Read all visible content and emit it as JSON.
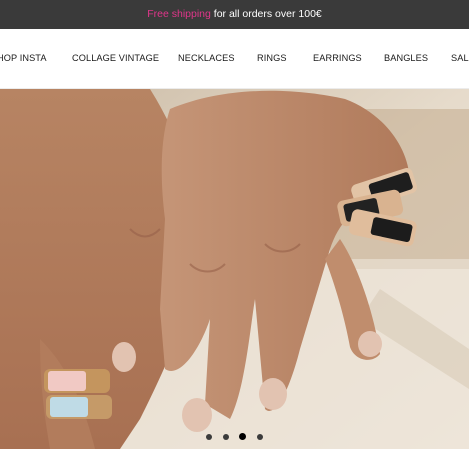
{
  "announcement": {
    "highlight": "Free shipping",
    "rest": " for all orders over 100€"
  },
  "nav": {
    "items": [
      {
        "label": "HOP INSTA"
      },
      {
        "label": "COLLAGE VINTAGE"
      },
      {
        "label": "NECKLACES"
      },
      {
        "label": "RINGS"
      },
      {
        "label": "EARRINGS"
      },
      {
        "label": "BANGLES"
      },
      {
        "label": "SALE"
      }
    ]
  },
  "hero": {
    "slide_count": 4,
    "active_slide": 3
  },
  "colors": {
    "announcement_bg": "#3a3a3a",
    "highlight": "#e0368a"
  }
}
